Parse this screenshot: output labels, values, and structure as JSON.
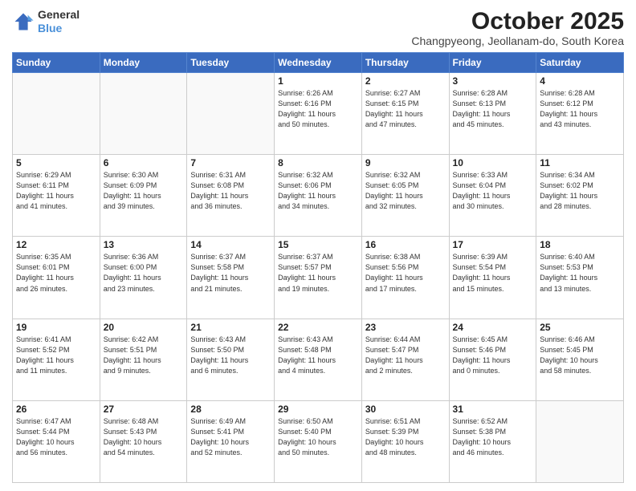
{
  "header": {
    "logo_general": "General",
    "logo_blue": "Blue",
    "month_title": "October 2025",
    "subtitle": "Changpyeong, Jeollanam-do, South Korea"
  },
  "weekdays": [
    "Sunday",
    "Monday",
    "Tuesday",
    "Wednesday",
    "Thursday",
    "Friday",
    "Saturday"
  ],
  "weeks": [
    [
      {
        "day": "",
        "info": ""
      },
      {
        "day": "",
        "info": ""
      },
      {
        "day": "",
        "info": ""
      },
      {
        "day": "1",
        "info": "Sunrise: 6:26 AM\nSunset: 6:16 PM\nDaylight: 11 hours\nand 50 minutes."
      },
      {
        "day": "2",
        "info": "Sunrise: 6:27 AM\nSunset: 6:15 PM\nDaylight: 11 hours\nand 47 minutes."
      },
      {
        "day": "3",
        "info": "Sunrise: 6:28 AM\nSunset: 6:13 PM\nDaylight: 11 hours\nand 45 minutes."
      },
      {
        "day": "4",
        "info": "Sunrise: 6:28 AM\nSunset: 6:12 PM\nDaylight: 11 hours\nand 43 minutes."
      }
    ],
    [
      {
        "day": "5",
        "info": "Sunrise: 6:29 AM\nSunset: 6:11 PM\nDaylight: 11 hours\nand 41 minutes."
      },
      {
        "day": "6",
        "info": "Sunrise: 6:30 AM\nSunset: 6:09 PM\nDaylight: 11 hours\nand 39 minutes."
      },
      {
        "day": "7",
        "info": "Sunrise: 6:31 AM\nSunset: 6:08 PM\nDaylight: 11 hours\nand 36 minutes."
      },
      {
        "day": "8",
        "info": "Sunrise: 6:32 AM\nSunset: 6:06 PM\nDaylight: 11 hours\nand 34 minutes."
      },
      {
        "day": "9",
        "info": "Sunrise: 6:32 AM\nSunset: 6:05 PM\nDaylight: 11 hours\nand 32 minutes."
      },
      {
        "day": "10",
        "info": "Sunrise: 6:33 AM\nSunset: 6:04 PM\nDaylight: 11 hours\nand 30 minutes."
      },
      {
        "day": "11",
        "info": "Sunrise: 6:34 AM\nSunset: 6:02 PM\nDaylight: 11 hours\nand 28 minutes."
      }
    ],
    [
      {
        "day": "12",
        "info": "Sunrise: 6:35 AM\nSunset: 6:01 PM\nDaylight: 11 hours\nand 26 minutes."
      },
      {
        "day": "13",
        "info": "Sunrise: 6:36 AM\nSunset: 6:00 PM\nDaylight: 11 hours\nand 23 minutes."
      },
      {
        "day": "14",
        "info": "Sunrise: 6:37 AM\nSunset: 5:58 PM\nDaylight: 11 hours\nand 21 minutes."
      },
      {
        "day": "15",
        "info": "Sunrise: 6:37 AM\nSunset: 5:57 PM\nDaylight: 11 hours\nand 19 minutes."
      },
      {
        "day": "16",
        "info": "Sunrise: 6:38 AM\nSunset: 5:56 PM\nDaylight: 11 hours\nand 17 minutes."
      },
      {
        "day": "17",
        "info": "Sunrise: 6:39 AM\nSunset: 5:54 PM\nDaylight: 11 hours\nand 15 minutes."
      },
      {
        "day": "18",
        "info": "Sunrise: 6:40 AM\nSunset: 5:53 PM\nDaylight: 11 hours\nand 13 minutes."
      }
    ],
    [
      {
        "day": "19",
        "info": "Sunrise: 6:41 AM\nSunset: 5:52 PM\nDaylight: 11 hours\nand 11 minutes."
      },
      {
        "day": "20",
        "info": "Sunrise: 6:42 AM\nSunset: 5:51 PM\nDaylight: 11 hours\nand 9 minutes."
      },
      {
        "day": "21",
        "info": "Sunrise: 6:43 AM\nSunset: 5:50 PM\nDaylight: 11 hours\nand 6 minutes."
      },
      {
        "day": "22",
        "info": "Sunrise: 6:43 AM\nSunset: 5:48 PM\nDaylight: 11 hours\nand 4 minutes."
      },
      {
        "day": "23",
        "info": "Sunrise: 6:44 AM\nSunset: 5:47 PM\nDaylight: 11 hours\nand 2 minutes."
      },
      {
        "day": "24",
        "info": "Sunrise: 6:45 AM\nSunset: 5:46 PM\nDaylight: 11 hours\nand 0 minutes."
      },
      {
        "day": "25",
        "info": "Sunrise: 6:46 AM\nSunset: 5:45 PM\nDaylight: 10 hours\nand 58 minutes."
      }
    ],
    [
      {
        "day": "26",
        "info": "Sunrise: 6:47 AM\nSunset: 5:44 PM\nDaylight: 10 hours\nand 56 minutes."
      },
      {
        "day": "27",
        "info": "Sunrise: 6:48 AM\nSunset: 5:43 PM\nDaylight: 10 hours\nand 54 minutes."
      },
      {
        "day": "28",
        "info": "Sunrise: 6:49 AM\nSunset: 5:41 PM\nDaylight: 10 hours\nand 52 minutes."
      },
      {
        "day": "29",
        "info": "Sunrise: 6:50 AM\nSunset: 5:40 PM\nDaylight: 10 hours\nand 50 minutes."
      },
      {
        "day": "30",
        "info": "Sunrise: 6:51 AM\nSunset: 5:39 PM\nDaylight: 10 hours\nand 48 minutes."
      },
      {
        "day": "31",
        "info": "Sunrise: 6:52 AM\nSunset: 5:38 PM\nDaylight: 10 hours\nand 46 minutes."
      },
      {
        "day": "",
        "info": ""
      }
    ]
  ]
}
